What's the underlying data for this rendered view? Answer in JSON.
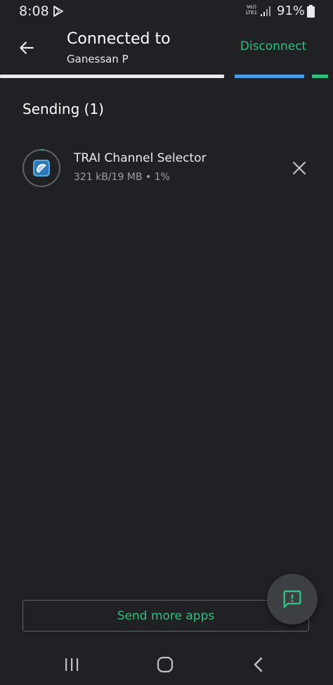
{
  "status_bar": {
    "time": "8:08",
    "network_line1": "Vo))",
    "network_line2": "LTE1",
    "battery": "91%"
  },
  "header": {
    "title": "Connected to",
    "subtitle": "Ganessan P",
    "disconnect_label": "Disconnect"
  },
  "progress_segments": [
    {
      "color": "#e8eaed"
    },
    {
      "color": "#4c9be8"
    },
    {
      "color": "#2fbf7f"
    }
  ],
  "section": {
    "title": "Sending (1)"
  },
  "transfer_item": {
    "name": "TRAI Channel Selector",
    "status": "321 kB/19 MB • 1%",
    "progress_fraction": 0.01
  },
  "bottom": {
    "send_more_label": "Send more apps"
  },
  "colors": {
    "accent": "#2fbf7f",
    "background": "#202124",
    "fab": "#3c4043"
  },
  "icons": {
    "back": "arrow-left-icon",
    "cancel": "close-icon",
    "feedback": "feedback-icon",
    "nav_recents": "recents-icon",
    "nav_home": "home-icon",
    "nav_back": "chevron-left-icon"
  }
}
